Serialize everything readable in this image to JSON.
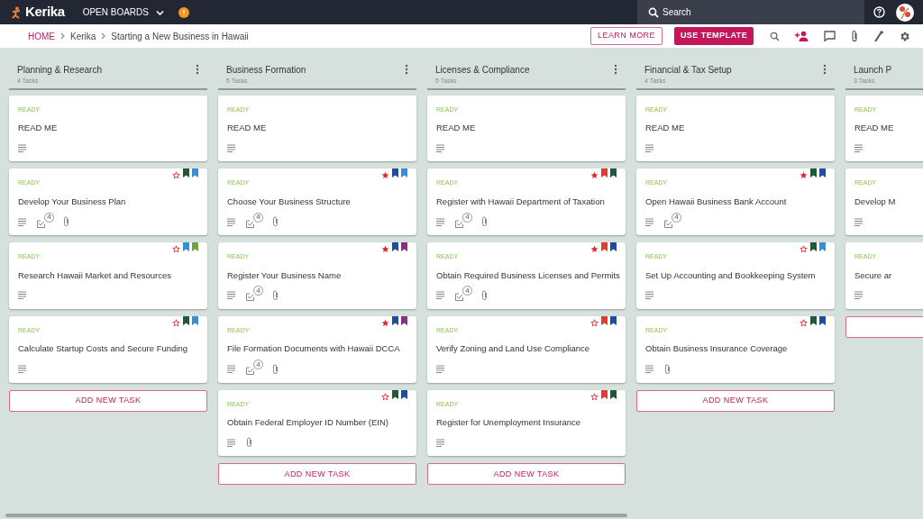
{
  "topbar": {
    "logo": "Kerika",
    "menu": "OPEN BOARDS",
    "alert_badge": "!",
    "search": {
      "placeholder": "Search"
    }
  },
  "breadcrumb": [
    "HOME",
    "Kerika",
    "Starting a New Business in Hawaii"
  ],
  "actions": {
    "learn_more": "LEARN MORE",
    "use_template": "USE TEMPLATE"
  },
  "columns": [
    {
      "title": "Planning & Research",
      "count": "4 Tasks",
      "add_label": "ADD NEW TASK",
      "cards": [
        {
          "status": "READY",
          "title": "READ ME",
          "badges": [
            {
              "kind": "description"
            }
          ]
        },
        {
          "status": "READY",
          "title": "Develop Your Business Plan",
          "starred": false,
          "tags": [
            {
              "color": "#1d5a3a"
            },
            {
              "color": "#2f8fe0"
            }
          ],
          "badges": [
            {
              "kind": "description"
            },
            {
              "kind": "checklist",
              "count": "4"
            },
            {
              "kind": "attachment"
            }
          ]
        },
        {
          "status": "READY",
          "title": "Research Hawaii Market and Resources",
          "starred": false,
          "tags": [
            {
              "color": "#2f8fe0"
            },
            {
              "color": "#6aa83a"
            }
          ],
          "badges": [
            {
              "kind": "description"
            }
          ]
        },
        {
          "status": "READY",
          "title": "Calculate Startup Costs and Secure Funding",
          "starred": false,
          "tags": [
            {
              "color": "#1d5a3a"
            },
            {
              "color": "#2f8fe0"
            }
          ],
          "badges": [
            {
              "kind": "description"
            }
          ]
        }
      ]
    },
    {
      "title": "Business Formation",
      "count": "5 Tasks",
      "add_label": "ADD NEW TASK",
      "cards": [
        {
          "status": "READY",
          "title": "READ ME",
          "badges": [
            {
              "kind": "description"
            }
          ]
        },
        {
          "status": "READY",
          "title": "Choose Your Business Structure",
          "starred": true,
          "tags": [
            {
              "color": "#1a4ea6"
            },
            {
              "color": "#2f8fe0"
            }
          ],
          "badges": [
            {
              "kind": "description"
            },
            {
              "kind": "checklist",
              "count": "4"
            },
            {
              "kind": "attachment"
            }
          ]
        },
        {
          "status": "READY",
          "title": "Register Your Business Name",
          "starred": true,
          "tags": [
            {
              "color": "#1a4ea6"
            },
            {
              "color": "#8e2a8c"
            }
          ],
          "badges": [
            {
              "kind": "description"
            },
            {
              "kind": "checklist",
              "count": "4"
            },
            {
              "kind": "attachment"
            }
          ]
        },
        {
          "status": "READY",
          "title": "File Formation Documents with Hawaii DCCA",
          "starred": true,
          "tags": [
            {
              "color": "#1a4ea6"
            },
            {
              "color": "#8e2a8c"
            }
          ],
          "badges": [
            {
              "kind": "description"
            },
            {
              "kind": "checklist",
              "count": "4"
            },
            {
              "kind": "attachment"
            }
          ]
        },
        {
          "status": "READY",
          "title": "Obtain Federal Employer ID Number (EIN)",
          "starred": false,
          "tags": [
            {
              "color": "#1d5a3a"
            },
            {
              "color": "#1a4ea6"
            }
          ],
          "badges": [
            {
              "kind": "description"
            },
            {
              "kind": "attachment"
            }
          ]
        }
      ]
    },
    {
      "title": "Licenses & Compliance",
      "count": "5 Tasks",
      "add_label": "ADD NEW TASK",
      "cards": [
        {
          "status": "READY",
          "title": "READ ME",
          "badges": [
            {
              "kind": "description"
            }
          ]
        },
        {
          "status": "READY",
          "title": "Register with Hawaii Department of Taxation",
          "starred": true,
          "tags": [
            {
              "color": "#e53a30"
            },
            {
              "color": "#1d5a3a"
            }
          ],
          "badges": [
            {
              "kind": "description"
            },
            {
              "kind": "checklist",
              "count": "4"
            },
            {
              "kind": "attachment"
            }
          ]
        },
        {
          "status": "READY",
          "title": "Obtain Required Business Licenses and Permits",
          "starred": true,
          "tags": [
            {
              "color": "#e53a30"
            },
            {
              "color": "#1a4ea6"
            }
          ],
          "badges": [
            {
              "kind": "description"
            },
            {
              "kind": "checklist",
              "count": "4"
            },
            {
              "kind": "attachment"
            }
          ]
        },
        {
          "status": "READY",
          "title": "Verify Zoning and Land Use Compliance",
          "starred": false,
          "tags": [
            {
              "color": "#e53a30"
            },
            {
              "color": "#1a4ea6"
            }
          ],
          "badges": [
            {
              "kind": "description"
            }
          ]
        },
        {
          "status": "READY",
          "title": "Register for Unemployment Insurance",
          "starred": false,
          "tags": [
            {
              "color": "#e53a30"
            },
            {
              "color": "#1d5a3a"
            }
          ],
          "badges": [
            {
              "kind": "description"
            }
          ]
        }
      ]
    },
    {
      "title": "Financial & Tax Setup",
      "count": "4 Tasks",
      "add_label": "ADD NEW TASK",
      "cards": [
        {
          "status": "READY",
          "title": "READ ME",
          "badges": [
            {
              "kind": "description"
            }
          ]
        },
        {
          "status": "READY",
          "title": "Open Hawaii Business Bank Account",
          "starred": true,
          "tags": [
            {
              "color": "#1d5a3a"
            },
            {
              "color": "#1a4ea6"
            }
          ],
          "badges": [
            {
              "kind": "description"
            },
            {
              "kind": "checklist",
              "count": "4"
            }
          ]
        },
        {
          "status": "READY",
          "title": "Set Up Accounting and Bookkeeping System",
          "starred": false,
          "tags": [
            {
              "color": "#1d5a3a"
            },
            {
              "color": "#2f8fe0"
            }
          ],
          "badges": [
            {
              "kind": "description"
            }
          ]
        },
        {
          "status": "READY",
          "title": "Obtain Business Insurance Coverage",
          "starred": false,
          "tags": [
            {
              "color": "#1d5a3a"
            },
            {
              "color": "#1a4ea6"
            }
          ],
          "badges": [
            {
              "kind": "description"
            },
            {
              "kind": "attachment"
            }
          ]
        }
      ]
    },
    {
      "title": "Launch P",
      "count": "3 Tasks",
      "cards": [
        {
          "status": "READY",
          "title": "READ ME",
          "badges": [
            {
              "kind": "description"
            }
          ]
        },
        {
          "status": "READY",
          "title": "Develop M",
          "badges": [
            {
              "kind": "description"
            }
          ]
        },
        {
          "status": "READY",
          "title": "Secure ar",
          "badges": [
            {
              "kind": "description"
            }
          ]
        }
      ]
    }
  ]
}
